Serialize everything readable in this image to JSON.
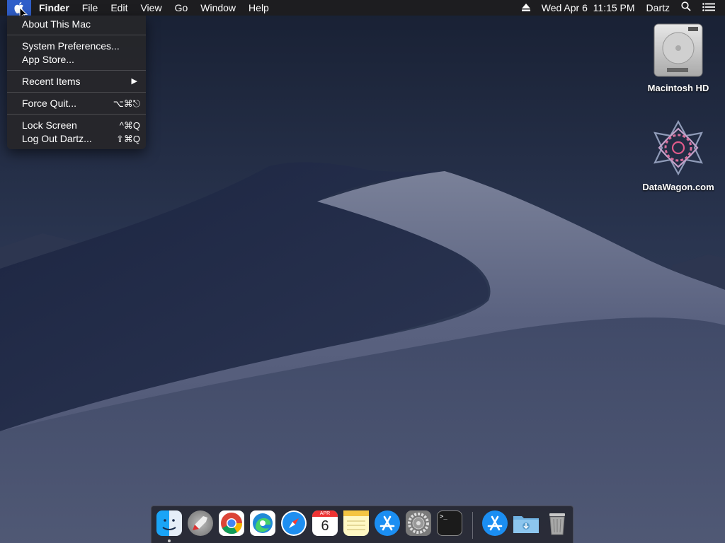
{
  "menubar": {
    "apple_icon": "apple-icon",
    "app_name": "Finder",
    "menus": [
      "File",
      "Edit",
      "View",
      "Go",
      "Window",
      "Help"
    ],
    "status": {
      "eject_icon": "eject-icon",
      "datetime": "Wed Apr 6  11:15 PM",
      "user": "Dartz",
      "search_icon": "search-icon",
      "list_icon": "list-icon"
    }
  },
  "apple_menu": {
    "about": "About This Mac",
    "system_prefs": "System Preferences...",
    "app_store": "App Store...",
    "recent_items": "Recent Items",
    "force_quit": "Force Quit...",
    "force_quit_shortcut": "⌥⌘⎋",
    "lock_screen": "Lock Screen",
    "lock_screen_shortcut": "^⌘Q",
    "log_out": "Log Out Dartz...",
    "log_out_shortcut": "⇧⌘Q"
  },
  "desktop_icons": [
    {
      "label": "Macintosh HD",
      "icon": "hard-drive-icon"
    },
    {
      "label": "DataWagon.com",
      "icon": "network-volume-icon"
    }
  ],
  "dock": {
    "items": [
      "finder-icon",
      "launchpad-icon",
      "chrome-icon",
      "edge-icon",
      "safari-icon",
      "calendar-icon",
      "notes-icon",
      "app-store-icon",
      "system-preferences-icon",
      "terminal-icon",
      "app-store-downloads-icon",
      "downloads-folder-icon",
      "trash-icon"
    ],
    "calendar_month": "APR",
    "calendar_day": "6",
    "terminal_prompt": ">_"
  },
  "colors": {
    "menu_highlight": "#2f5ec9",
    "menubar_bg": "#1d1d20"
  }
}
